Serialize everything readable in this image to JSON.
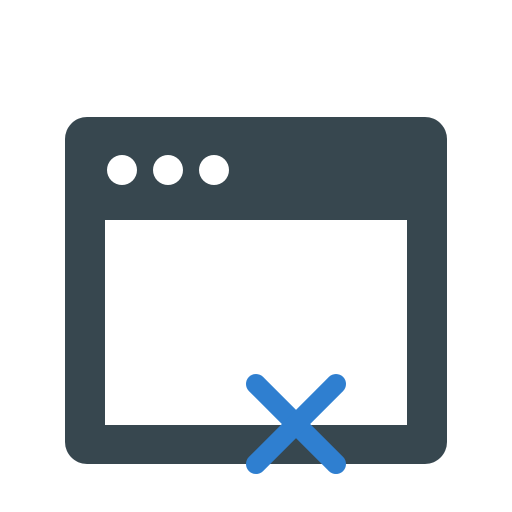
{
  "icon": {
    "name": "browser-window-error-icon",
    "frame_color": "#37474f",
    "dot_color": "#ffffff",
    "pane_color": "#ffffff",
    "cross_color": "#2f7fd0",
    "window_dots": [
      "dot",
      "dot",
      "dot"
    ],
    "symbol": "close-x-icon"
  }
}
